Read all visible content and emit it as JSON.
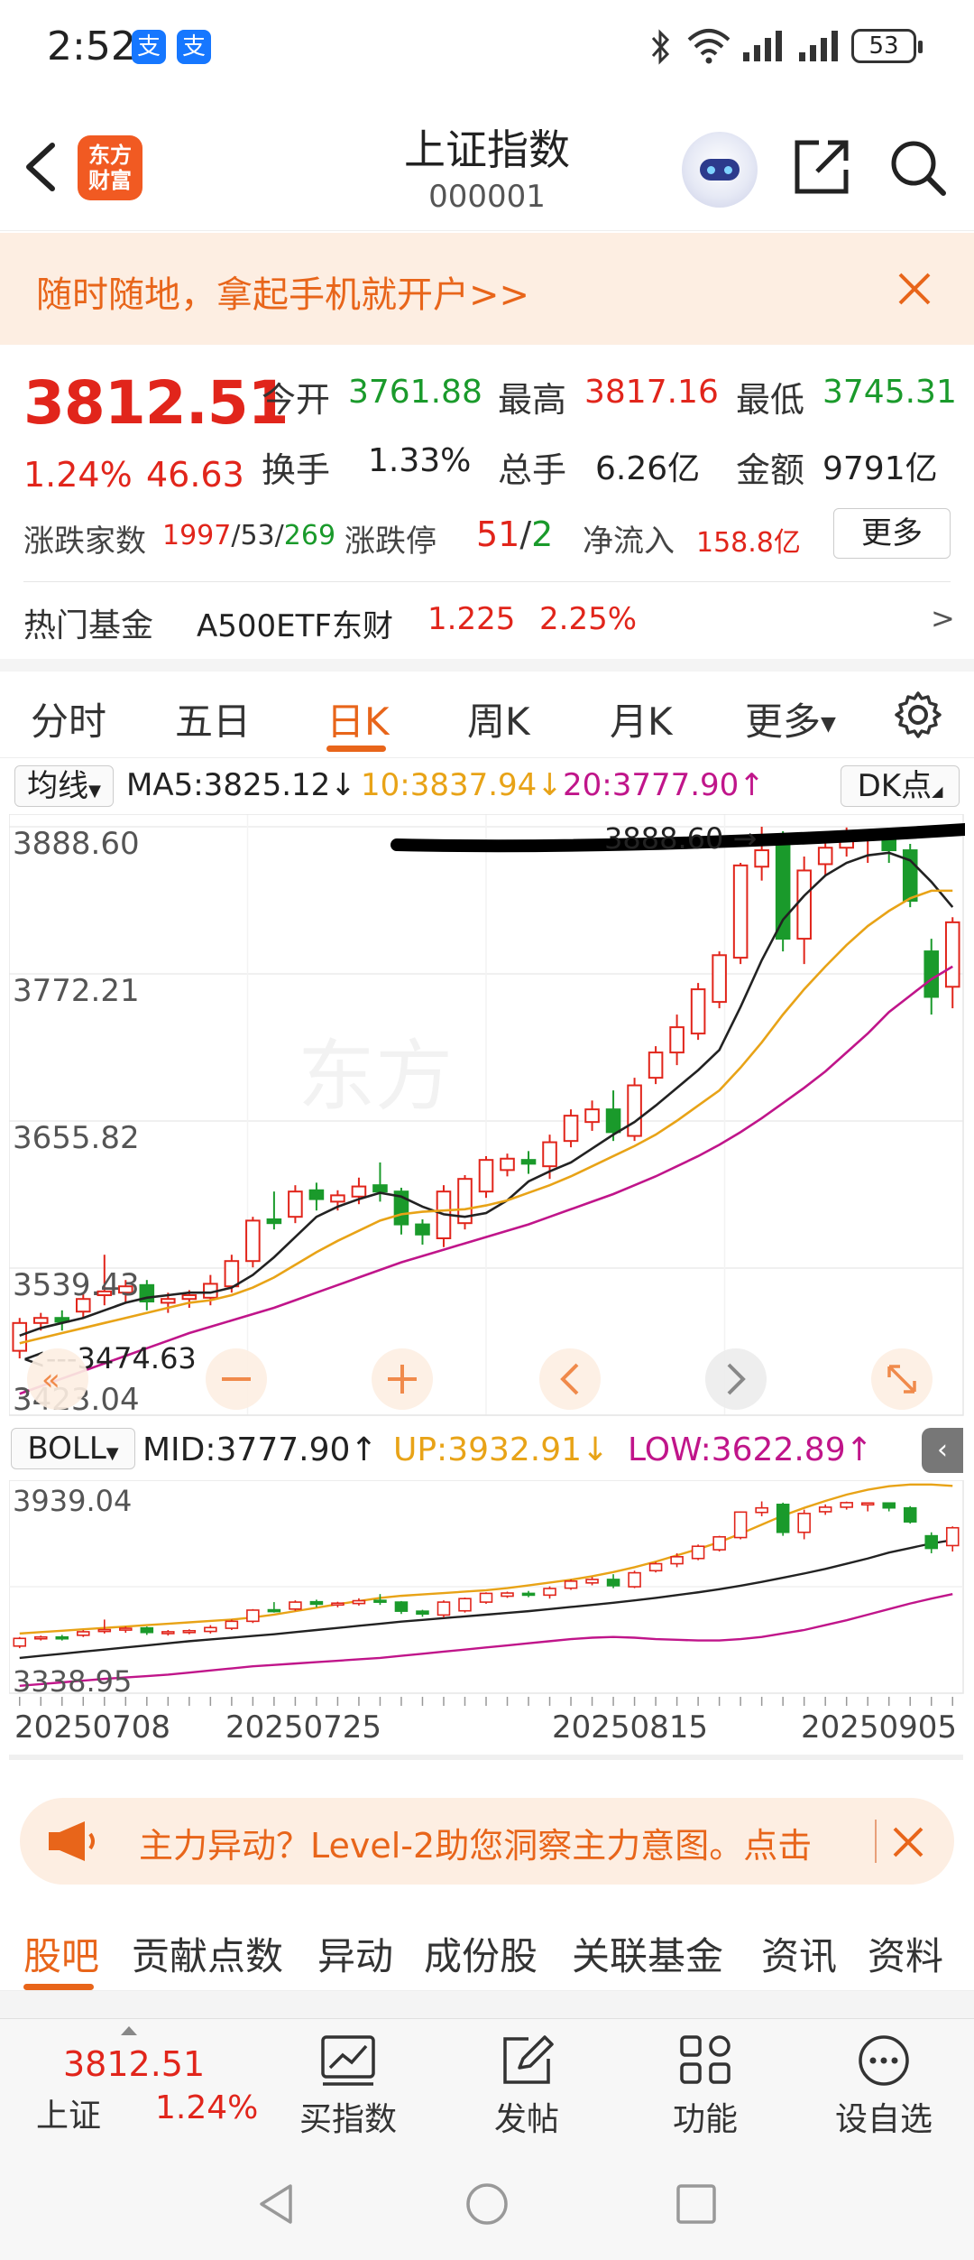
{
  "status_bar": {
    "time": "2:52",
    "battery": "53",
    "alipay_glyph": "支"
  },
  "header": {
    "logo_line1": "东方",
    "logo_line2": "财富",
    "title": "上证指数",
    "code": "000001"
  },
  "banner": {
    "text": "随时随地，拿起手机就开户>>"
  },
  "quote": {
    "price": "3812.51",
    "change_pct": "1.24%",
    "change": "46.63",
    "open_label": "今开",
    "open": "3761.88",
    "high_label": "最高",
    "high": "3817.16",
    "low_label": "最低",
    "low": "3745.31",
    "turnover_label": "换手",
    "turnover": "1.33%",
    "volume_label": "总手",
    "volume": "6.26亿",
    "amount_label": "金额",
    "amount": "9791亿",
    "breadth_label": "涨跌家数",
    "breadth_up": "1997",
    "breadth_flat": "53",
    "breadth_down": "269",
    "limit_label": "涨跌停",
    "limit_up": "51",
    "limit_down": "2",
    "inflow_label": "净流入",
    "inflow": "158.8亿",
    "more_label": "更多",
    "fund_label": "热门基金",
    "fund_name": "A500ETF东财",
    "fund_price": "1.225",
    "fund_pct": "2.25%",
    "fund_arrow": ">"
  },
  "tabs": [
    "分时",
    "五日",
    "日K",
    "周K",
    "月K",
    "更多"
  ],
  "active_tab": "日K",
  "ma_legend": {
    "selector": "均线",
    "ma5": "MA5:3825.12↓",
    "ma10": "10:3837.94↓",
    "ma20": "20:3777.90↑",
    "dk": "DK点",
    "colors": {
      "ma5": "#222222",
      "ma10": "#e8a317",
      "ma20": "#c0158a",
      "up": "#e1251b",
      "down": "#1a9a2b"
    }
  },
  "kline_axis": {
    "y1": "3888.60",
    "y2": "3772.21",
    "y3": "3655.82",
    "y4": "3539.43",
    "y5": "3423.04"
  },
  "kline_annotations": {
    "high_marker": "3888.60",
    "low_marker": "3474.63"
  },
  "boll_legend": {
    "selector": "BOLL",
    "mid": "MID:3777.90↑",
    "up": "UP:3932.91↓",
    "low": "LOW:3622.89↑"
  },
  "boll_axis": {
    "top": "3939.04",
    "bottom": "3338.95"
  },
  "dates": [
    "20250708",
    "20250725",
    "20250815",
    "20250905"
  ],
  "level2_banner": {
    "text": "主力异动？Level-2助您洞察主力意图。点击"
  },
  "sub_tabs": [
    "股吧",
    "贡献点数",
    "异动",
    "成份股",
    "关联基金",
    "资讯",
    "资料"
  ],
  "active_sub_tab": "股吧",
  "bottom_nav": {
    "price": "3812.51",
    "name": "上证",
    "pct": "1.24%",
    "items": [
      "买指数",
      "发帖",
      "功能",
      "设自选"
    ]
  },
  "chart_data": {
    "type": "candlestick",
    "ylim": [
      3423.04,
      3888.6
    ],
    "y_ticks": [
      3888.6,
      3772.21,
      3655.82,
      3539.43,
      3423.04
    ],
    "x_ticks": [
      "20250708",
      "20250725",
      "20250815",
      "20250905"
    ],
    "candles": [
      [
        3474,
        3496,
        3468,
        3500
      ],
      [
        3496,
        3500,
        3490,
        3504
      ],
      [
        3500,
        3497,
        3490,
        3506
      ],
      [
        3505,
        3515,
        3500,
        3520
      ],
      [
        3518,
        3521,
        3510,
        3550
      ],
      [
        3520,
        3525,
        3512,
        3530
      ],
      [
        3526,
        3513,
        3506,
        3530
      ],
      [
        3512,
        3515,
        3504,
        3520
      ],
      [
        3515,
        3518,
        3508,
        3522
      ],
      [
        3516,
        3527,
        3510,
        3534
      ],
      [
        3525,
        3545,
        3520,
        3550
      ],
      [
        3545,
        3577,
        3540,
        3580
      ],
      [
        3578,
        3575,
        3570,
        3600
      ],
      [
        3580,
        3600,
        3575,
        3605
      ],
      [
        3601,
        3594,
        3585,
        3607
      ],
      [
        3592,
        3597,
        3585,
        3601
      ],
      [
        3596,
        3604,
        3590,
        3611
      ],
      [
        3605,
        3600,
        3592,
        3623
      ],
      [
        3600,
        3574,
        3566,
        3603
      ],
      [
        3574,
        3566,
        3558,
        3578
      ],
      [
        3563,
        3600,
        3556,
        3605
      ],
      [
        3575,
        3610,
        3570,
        3613
      ],
      [
        3600,
        3625,
        3595,
        3628
      ],
      [
        3617,
        3626,
        3612,
        3630
      ],
      [
        3625,
        3622,
        3614,
        3632
      ],
      [
        3620,
        3639,
        3610,
        3645
      ],
      [
        3640,
        3660,
        3635,
        3665
      ],
      [
        3655,
        3665,
        3648,
        3672
      ],
      [
        3665,
        3647,
        3640,
        3680
      ],
      [
        3644,
        3684,
        3640,
        3690
      ],
      [
        3690,
        3710,
        3685,
        3715
      ],
      [
        3710,
        3730,
        3700,
        3740
      ],
      [
        3725,
        3760,
        3720,
        3765
      ],
      [
        3750,
        3787,
        3745,
        3790
      ],
      [
        3785,
        3858,
        3780,
        3860
      ],
      [
        3857,
        3870,
        3846,
        3888.6
      ],
      [
        3880,
        3800,
        3790,
        3885
      ],
      [
        3800,
        3854,
        3780,
        3865
      ],
      [
        3859,
        3872,
        3850,
        3880
      ],
      [
        3872,
        3885,
        3865,
        3888
      ],
      [
        3880,
        3884,
        3860,
        3886
      ],
      [
        3884,
        3870,
        3860,
        3886
      ],
      [
        3870,
        3830,
        3825,
        3875
      ],
      [
        3790,
        3754,
        3740,
        3800
      ],
      [
        3762,
        3813,
        3745,
        3817
      ]
    ],
    "ma5": [
      3486,
      3492,
      3496,
      3500,
      3506,
      3512,
      3516,
      3518,
      3520,
      3520,
      3524,
      3534,
      3548,
      3564,
      3580,
      3588,
      3594,
      3599,
      3596,
      3588,
      3582,
      3580,
      3583,
      3593,
      3608,
      3616,
      3623,
      3634,
      3645,
      3655,
      3668,
      3682,
      3696,
      3712,
      3746,
      3783,
      3815,
      3834,
      3850,
      3860,
      3866,
      3868,
      3862,
      3845,
      3825
    ],
    "ma10": [
      3480,
      3484,
      3488,
      3492,
      3496,
      3500,
      3504,
      3508,
      3512,
      3514,
      3518,
      3524,
      3532,
      3542,
      3552,
      3561,
      3569,
      3577,
      3582,
      3584,
      3585,
      3586,
      3589,
      3593,
      3599,
      3605,
      3612,
      3620,
      3628,
      3636,
      3645,
      3656,
      3668,
      3680,
      3698,
      3718,
      3740,
      3760,
      3778,
      3795,
      3810,
      3822,
      3832,
      3838,
      3838
    ],
    "ma20": [
      3440,
      3446,
      3452,
      3458,
      3464,
      3470,
      3476,
      3482,
      3488,
      3493,
      3498,
      3503,
      3508,
      3514,
      3520,
      3526,
      3532,
      3538,
      3544,
      3549,
      3554,
      3559,
      3564,
      3569,
      3574,
      3580,
      3586,
      3592,
      3598,
      3605,
      3612,
      3620,
      3628,
      3637,
      3647,
      3658,
      3670,
      3682,
      3695,
      3710,
      3725,
      3742,
      3755,
      3768,
      3778
    ],
    "boll": {
      "ylim": [
        3338.95,
        3939.04
      ],
      "up": [
        3510,
        3514,
        3518,
        3522,
        3526,
        3530,
        3534,
        3538,
        3542,
        3546,
        3550,
        3556,
        3564,
        3574,
        3584,
        3594,
        3603,
        3612,
        3618,
        3622,
        3626,
        3630,
        3634,
        3640,
        3648,
        3656,
        3664,
        3674,
        3686,
        3700,
        3716,
        3734,
        3752,
        3772,
        3796,
        3822,
        3848,
        3870,
        3890,
        3908,
        3922,
        3932,
        3937,
        3937,
        3933
      ],
      "mid": [
        3440,
        3446,
        3452,
        3458,
        3464,
        3470,
        3476,
        3482,
        3488,
        3493,
        3498,
        3503,
        3508,
        3514,
        3520,
        3526,
        3532,
        3538,
        3544,
        3549,
        3554,
        3559,
        3564,
        3569,
        3574,
        3580,
        3586,
        3592,
        3598,
        3605,
        3612,
        3620,
        3628,
        3637,
        3647,
        3658,
        3670,
        3682,
        3695,
        3710,
        3725,
        3742,
        3755,
        3768,
        3778
      ],
      "low": [
        3360,
        3365,
        3370,
        3375,
        3380,
        3384,
        3388,
        3392,
        3398,
        3404,
        3410,
        3416,
        3420,
        3424,
        3428,
        3432,
        3436,
        3440,
        3446,
        3452,
        3458,
        3464,
        3470,
        3476,
        3482,
        3488,
        3494,
        3498,
        3500,
        3498,
        3494,
        3492,
        3490,
        3490,
        3494,
        3500,
        3510,
        3520,
        3534,
        3548,
        3564,
        3580,
        3596,
        3610,
        3623
      ]
    }
  }
}
